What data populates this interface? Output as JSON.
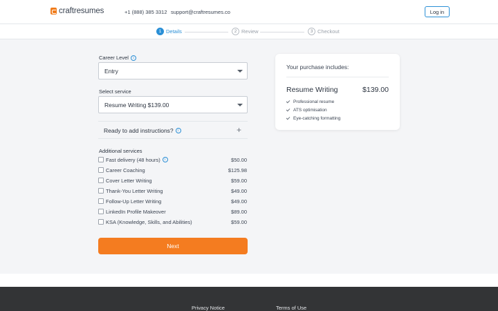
{
  "header": {
    "logo_text": "craftresumes",
    "phone": "+1 (888) 385 3312",
    "email": "support@craftresumes.co",
    "login_label": "Log in"
  },
  "steps": [
    {
      "num": "1",
      "label": "Details"
    },
    {
      "num": "2",
      "label": "Review"
    },
    {
      "num": "3",
      "label": "Checkout"
    }
  ],
  "form": {
    "career_level_label": "Career Level",
    "career_level_value": "Entry",
    "service_label": "Select service",
    "service_value": "Resume Writing $139.00",
    "instructions_label": "Ready to add instructions?",
    "additional_title": "Additional services",
    "services": [
      {
        "name": "Fast delivery (48 hours)",
        "price": "$50.00"
      },
      {
        "name": "Career Coaching",
        "price": "$125.98"
      },
      {
        "name": "Cover Letter Writing",
        "price": "$59.00"
      },
      {
        "name": "Thank-You Letter Writing",
        "price": "$49.00"
      },
      {
        "name": "Follow-Up Letter Writing",
        "price": "$49.00"
      },
      {
        "name": "LinkedIn Profile Makeover",
        "price": "$89.00"
      },
      {
        "name": "KSA (Knowledge, Skills, and Abilities)",
        "price": "$59.00"
      }
    ],
    "next_label": "Next"
  },
  "summary": {
    "title": "Your purchase includes:",
    "product": "Resume Writing",
    "price": "$139.00",
    "features": [
      "Professional resume",
      "ATS optimisation",
      "Eye-catching formatting"
    ]
  },
  "footer": {
    "privacy": "Privacy Notice",
    "terms": "Terms of Use"
  },
  "colors": {
    "accent": "#f47c20",
    "link_blue": "#2a8fd6"
  }
}
